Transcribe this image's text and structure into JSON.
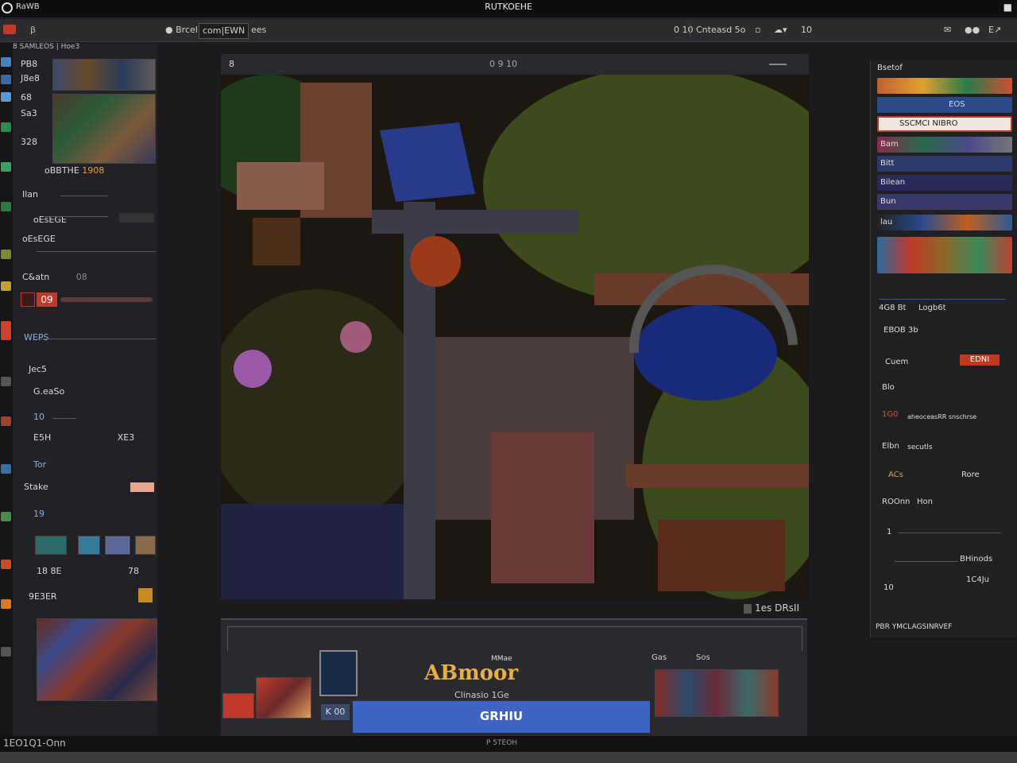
{
  "titlebar": {
    "app_name": "RaWB",
    "window_title": "RUTKOEHE"
  },
  "toolbar": {
    "items": [
      "Brcel",
      "com|EWN",
      "ees"
    ],
    "right_items": [
      "0 10",
      "Cnteasd 5o",
      "10"
    ]
  },
  "left_panel": {
    "header": "8 SAMLEOS | Hoe3",
    "rows": [
      {
        "label": "PB8",
        "value": "1908"
      },
      {
        "label": "J8e8",
        "value": ""
      },
      {
        "label": "68",
        "value": ""
      },
      {
        "label": "Sa3",
        "value": ""
      },
      {
        "label": "328",
        "value": ""
      },
      {
        "label": "oBBTHE",
        "value": ""
      },
      {
        "label": "Ilan",
        "value": ""
      },
      {
        "label": "oEsEGE",
        "value": ""
      },
      {
        "label": "C&atn",
        "value": "08"
      },
      {
        "label": "09",
        "value": ""
      },
      {
        "label": "WEPS",
        "value": ""
      },
      {
        "label": "Jec5",
        "value": ""
      },
      {
        "label": "G.eaSo",
        "value": ""
      },
      {
        "label": "10",
        "value": ""
      },
      {
        "label": "E5H",
        "value": "XE3"
      },
      {
        "label": "Tor",
        "value": ""
      },
      {
        "label": "Stake",
        "value": ""
      },
      {
        "label": "19",
        "value": ""
      },
      {
        "label": "18 8E",
        "value": "78"
      },
      {
        "label": "9E3ER",
        "value": ""
      }
    ]
  },
  "canvas": {
    "header_left": "8",
    "header_mid": "0 9 10",
    "zoom_label": "1es DRsII"
  },
  "asset_panel": {
    "logo_small": "MMae",
    "logo": "ABmoor",
    "logo_sub": "Clinasio 1Ge",
    "button_label": "GRHIU",
    "small_label": "K 00",
    "right_labels": [
      "Gas",
      "Sos"
    ]
  },
  "right_panel": {
    "title": "Bsetof",
    "rows": [
      "EOS",
      "SSCMCI NIBRO",
      "Bam",
      "Bitt",
      "Bilean",
      "Bun",
      "lau"
    ],
    "props": [
      {
        "label": "4G8 Bt",
        "value": "Logb6t"
      },
      {
        "label": "EBOB 3b",
        "value": ""
      },
      {
        "label": "Cuem",
        "value": "EDNI"
      },
      {
        "label": "Blo",
        "value": ""
      },
      {
        "label": "1G0",
        "value": "aheoceasRR snschrse"
      },
      {
        "label": "Elbn",
        "value": "secutls"
      },
      {
        "label": "ACs",
        "value": "Rore"
      },
      {
        "label": "ROOnn",
        "value": "Hon"
      },
      {
        "label": "1",
        "value": ""
      },
      {
        "label": "",
        "value": "BHinods"
      },
      {
        "label": "10",
        "value": "1C4Ju"
      },
      {
        "label": "",
        "value": "PBR YMCLAGSINRVEF"
      }
    ]
  },
  "statusbar": {
    "left_text": "1EO1Q1-Onn",
    "center_text": "P 5TEOH"
  },
  "colors": {
    "accent_blue": "#3f63c4",
    "selected_red": "#c0392b",
    "panel_bg": "#222226"
  },
  "icons": [
    "search-icon",
    "gear-icon",
    "lock-icon",
    "brush-icon",
    "layers-icon",
    "eye-icon",
    "play-icon",
    "undo-icon"
  ]
}
